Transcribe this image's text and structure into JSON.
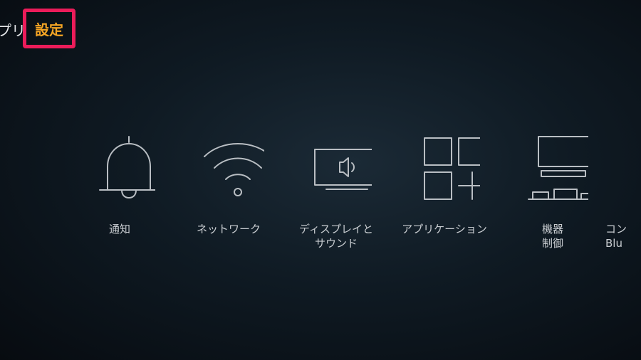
{
  "topnav": {
    "apps_label": "プリ",
    "settings_label": "設定"
  },
  "tiles": [
    {
      "label": "通知",
      "icon": "bell-icon"
    },
    {
      "label": "ネットワーク",
      "icon": "wifi-icon"
    },
    {
      "label": "ディスプレイと\nサウンド",
      "icon": "display-sound-icon"
    },
    {
      "label": "アプリケーション",
      "icon": "applications-icon"
    },
    {
      "label": "機器\n制御",
      "icon": "equipment-control-icon"
    },
    {
      "label": "コン\nBlu",
      "icon": ""
    }
  ],
  "colors": {
    "focus_border": "#ec1c5a",
    "active_text": "#f5a524"
  }
}
